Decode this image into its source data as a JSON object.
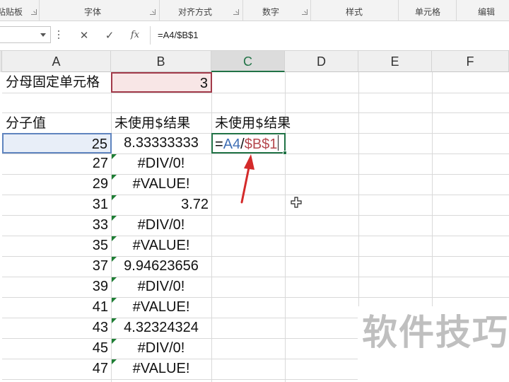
{
  "ribbon": {
    "groups": [
      "粘贴板",
      "字体",
      "对齐方式",
      "数字",
      "样式",
      "单元格",
      "编辑"
    ]
  },
  "formula_bar": {
    "cancel_glyph": "✕",
    "enter_glyph": "✓",
    "fx_label": "fx",
    "content": "=A4/$B$1"
  },
  "columns": [
    "A",
    "B",
    "C",
    "D",
    "E",
    "F"
  ],
  "active_column": "C",
  "cells": {
    "a1": "分母固定单元格",
    "b1": "3",
    "a3": "分子值",
    "b3": "未使用$结果",
    "c3": "未使用$结果",
    "c4_prefix": "=",
    "c4_ref_a": "A4",
    "c4_slash": "/",
    "c4_ref_b": "$B$1"
  },
  "rows": [
    {
      "a": "25",
      "b": "8.33333333"
    },
    {
      "a": "27",
      "b": "#DIV/0!"
    },
    {
      "a": "29",
      "b": "#VALUE!"
    },
    {
      "a": "31",
      "b": "3.72"
    },
    {
      "a": "33",
      "b": "#DIV/0!"
    },
    {
      "a": "35",
      "b": "#VALUE!"
    },
    {
      "a": "37",
      "b": "9.94623656"
    },
    {
      "a": "39",
      "b": "#DIV/0!"
    },
    {
      "a": "41",
      "b": "#VALUE!"
    },
    {
      "a": "43",
      "b": "4.32324324"
    },
    {
      "a": "45",
      "b": "#DIV/0!"
    },
    {
      "a": "47",
      "b": "#VALUE!"
    }
  ],
  "watermark": "软件技巧",
  "colors": {
    "excel_green": "#217346",
    "arrow_red": "#d42a2a",
    "ref_blue": "#3f6fb5",
    "ref_red": "#b5484e"
  }
}
